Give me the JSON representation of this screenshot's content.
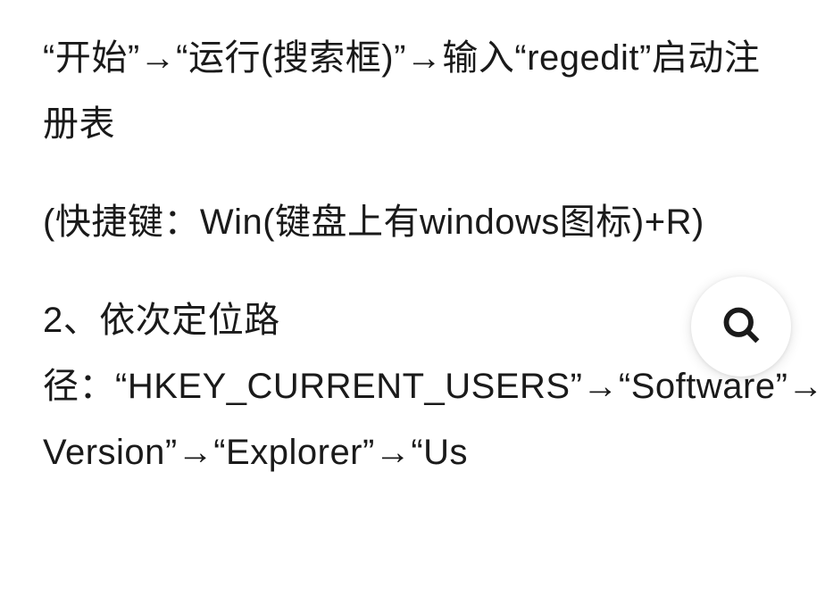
{
  "paragraphs": {
    "p1": "“开始”→“运行(搜索框)”→输入“regedit”启动注册表",
    "p2": "(快捷键：Win(键盘上有windows图标)+R)",
    "p3": "2、依次定位路径：“HKEY_CURRENT_USERS”→“Software”→“Microsoft”→“Windows”→“Current Version”→“Explorer”→“Us"
  },
  "icons": {
    "search": "search-icon"
  }
}
